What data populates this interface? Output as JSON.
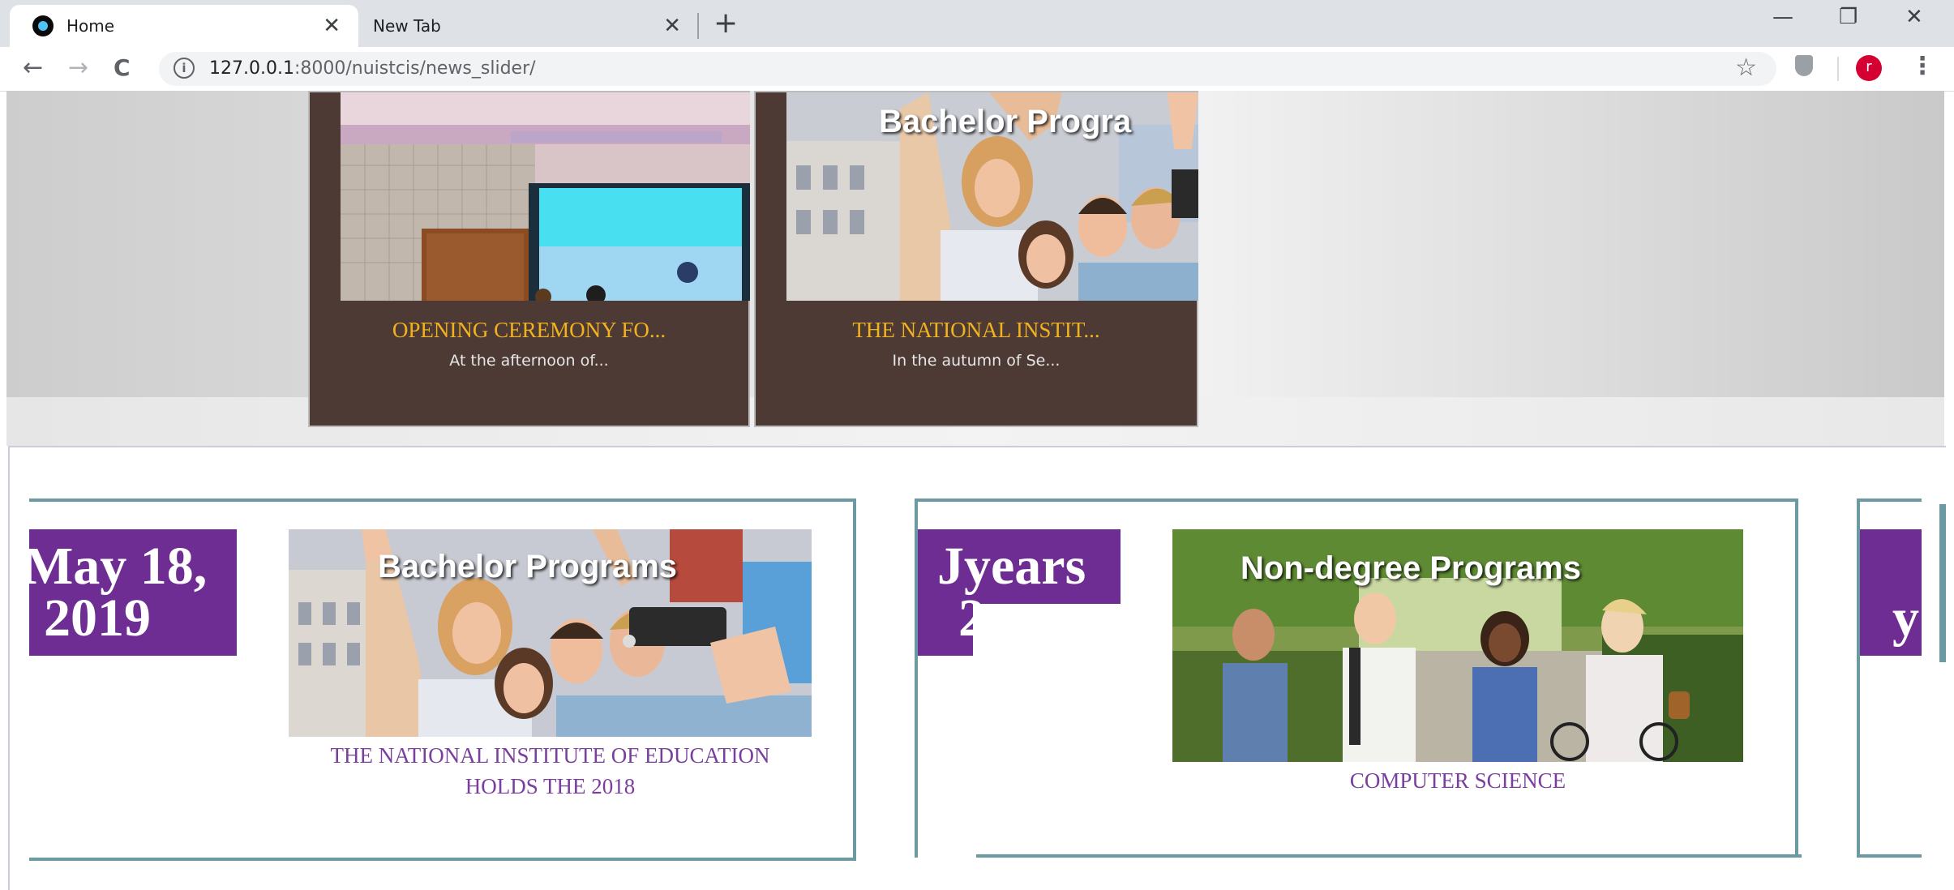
{
  "browser": {
    "tabs": [
      {
        "title": "Home",
        "close": "✕"
      },
      {
        "title": "New Tab",
        "close": "✕"
      }
    ],
    "new_tab": "+",
    "window_controls": {
      "minimize": "—",
      "restore": "❐",
      "close": "✕"
    },
    "nav": {
      "back": "←",
      "forward": "→",
      "reload": "C"
    },
    "url_host": "127.0.0.1",
    "url_path": ":8000/nuistcis/news_slider/",
    "bookmark_icon": "☆",
    "profile_initial": "r",
    "menu_icon": "⋮"
  },
  "slider": {
    "slides": [
      {
        "title": "OPENING CEREMONY FO...",
        "excerpt": "At the afternoon of..."
      },
      {
        "title": "THE NATIONAL INSTIT...",
        "excerpt": "In the autumn of Se...",
        "image_text": "Bachelor Progra"
      }
    ]
  },
  "news": {
    "cards": [
      {
        "date_line1": "May 18,",
        "date_line2": "2019",
        "image_text": "Bachelor Programs",
        "caption_line1": "THE NATIONAL INSTITUTE OF EDUCATION",
        "caption_line2": "HOLDS THE 2018"
      },
      {
        "date_line1": "Jyears",
        "date_line2": "2",
        "image_text": "Non-degree Programs",
        "caption": "COMPUTER SCIENCE"
      },
      {
        "date_line2": "y"
      }
    ]
  },
  "colors": {
    "date_block": "#6d2d93",
    "card_border": "#6c9aa3",
    "slide_bg": "#4e3a35",
    "slide_title": "#f0b21e",
    "news_caption": "#7a3f9e"
  }
}
